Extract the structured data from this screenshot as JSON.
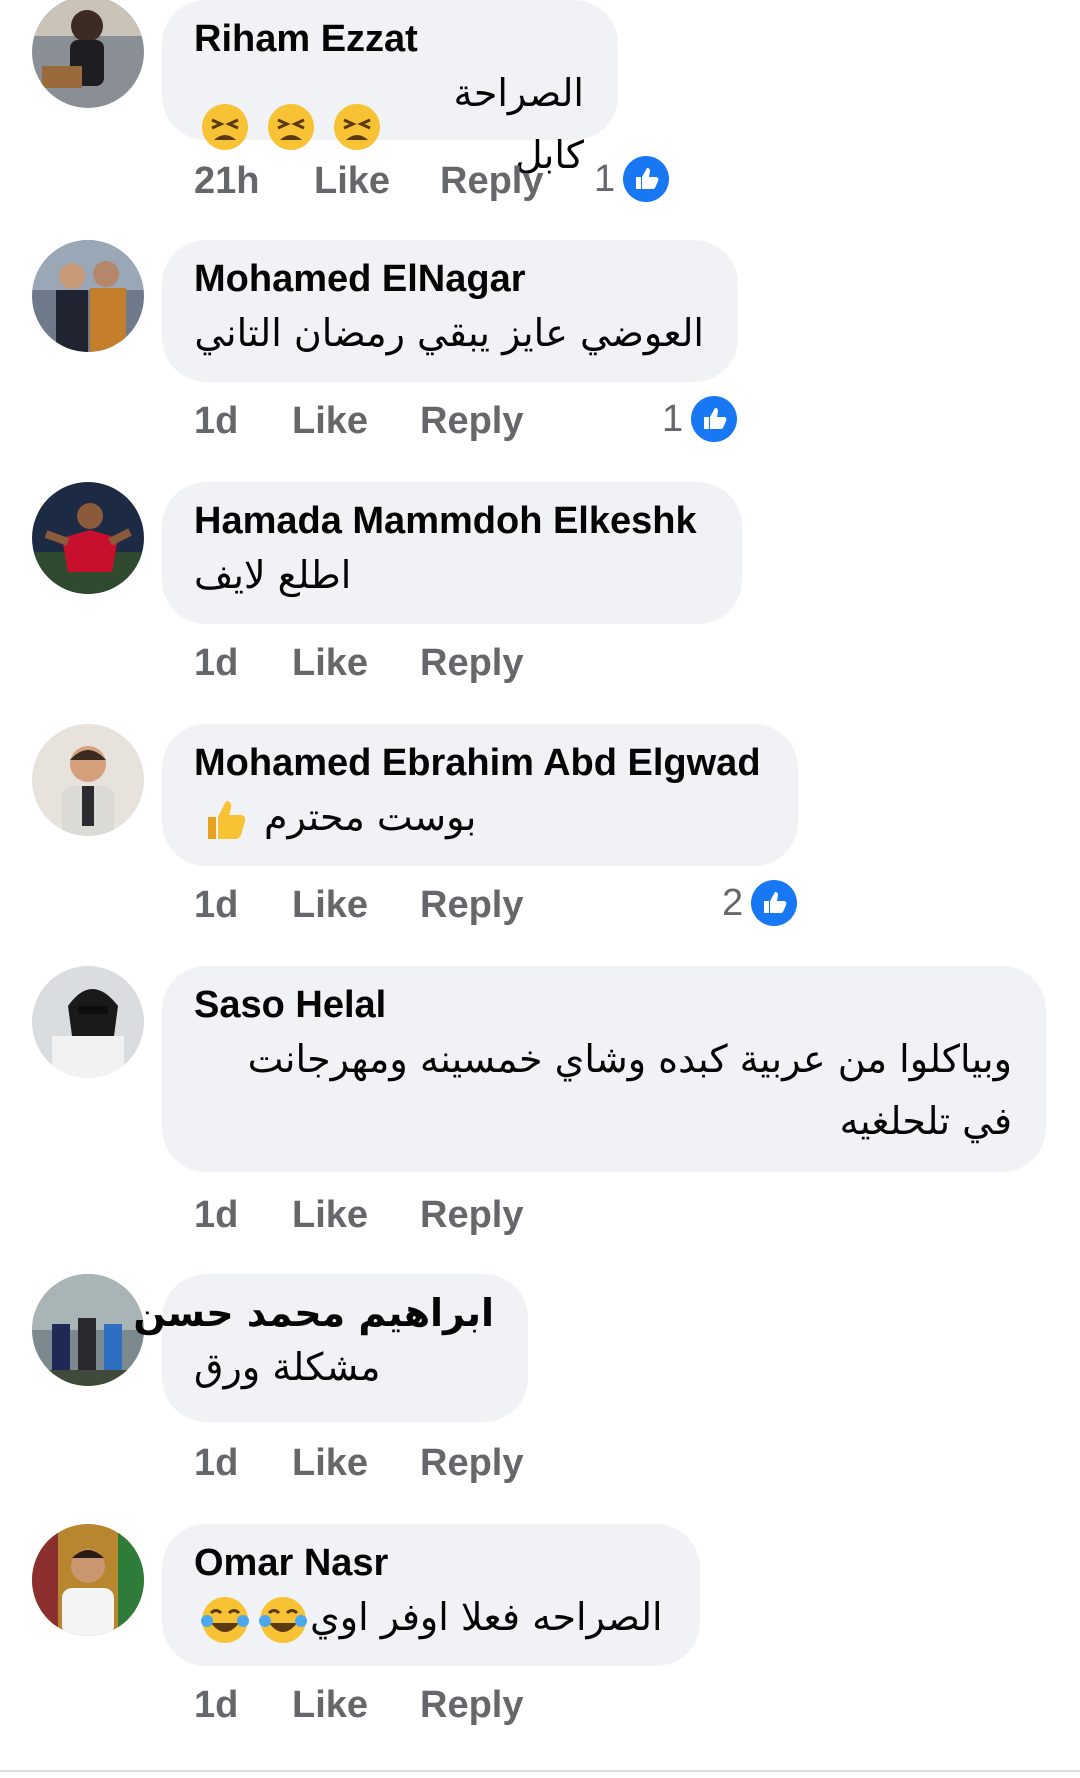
{
  "comments": [
    {
      "author": "Riham Ezzat",
      "text": "الصراحة كابل",
      "emoji": [
        "tired-face-icon",
        "tired-face-icon",
        "tired-face-icon"
      ],
      "time": "21h",
      "like": "Like",
      "reply": "Reply",
      "reactions": "1"
    },
    {
      "author": "Mohamed ElNagar",
      "text": "العوضي عايز يبقي رمضان التاني",
      "emoji": [],
      "time": "1d",
      "like": "Like",
      "reply": "Reply",
      "reactions": "1"
    },
    {
      "author": "Hamada Mammdoh Elkeshk",
      "text": "اطلع لايف",
      "emoji": [],
      "time": "1d",
      "like": "Like",
      "reply": "Reply",
      "reactions": ""
    },
    {
      "author": "Mohamed Ebrahim Abd Elgwad",
      "text": "بوست محترم",
      "emoji": [
        "thumbs-up-emoji-icon"
      ],
      "time": "1d",
      "like": "Like",
      "reply": "Reply",
      "reactions": "2"
    },
    {
      "author": "Saso Helal",
      "text": "وبياكلوا من عربية كبده وشاي خمسينه ومهرجانت في تلحلغيه",
      "emoji": [],
      "time": "1d",
      "like": "Like",
      "reply": "Reply",
      "reactions": ""
    },
    {
      "author": "ابراهيم محمد حسن",
      "text": "مشكلة ورق",
      "emoji": [],
      "time": "1d",
      "like": "Like",
      "reply": "Reply",
      "reactions": ""
    },
    {
      "author": "Omar Nasr",
      "text": "الصراحه فعلا اوفر اوي",
      "emoji": [
        "laughing-tears-icon",
        "laughing-tears-icon"
      ],
      "time": "1d",
      "like": "Like",
      "reply": "Reply",
      "reactions": ""
    }
  ],
  "colors": {
    "bubble": "#f0f2f5",
    "meta": "#65676b",
    "like_blue": "#1877f2",
    "text": "#050505"
  }
}
